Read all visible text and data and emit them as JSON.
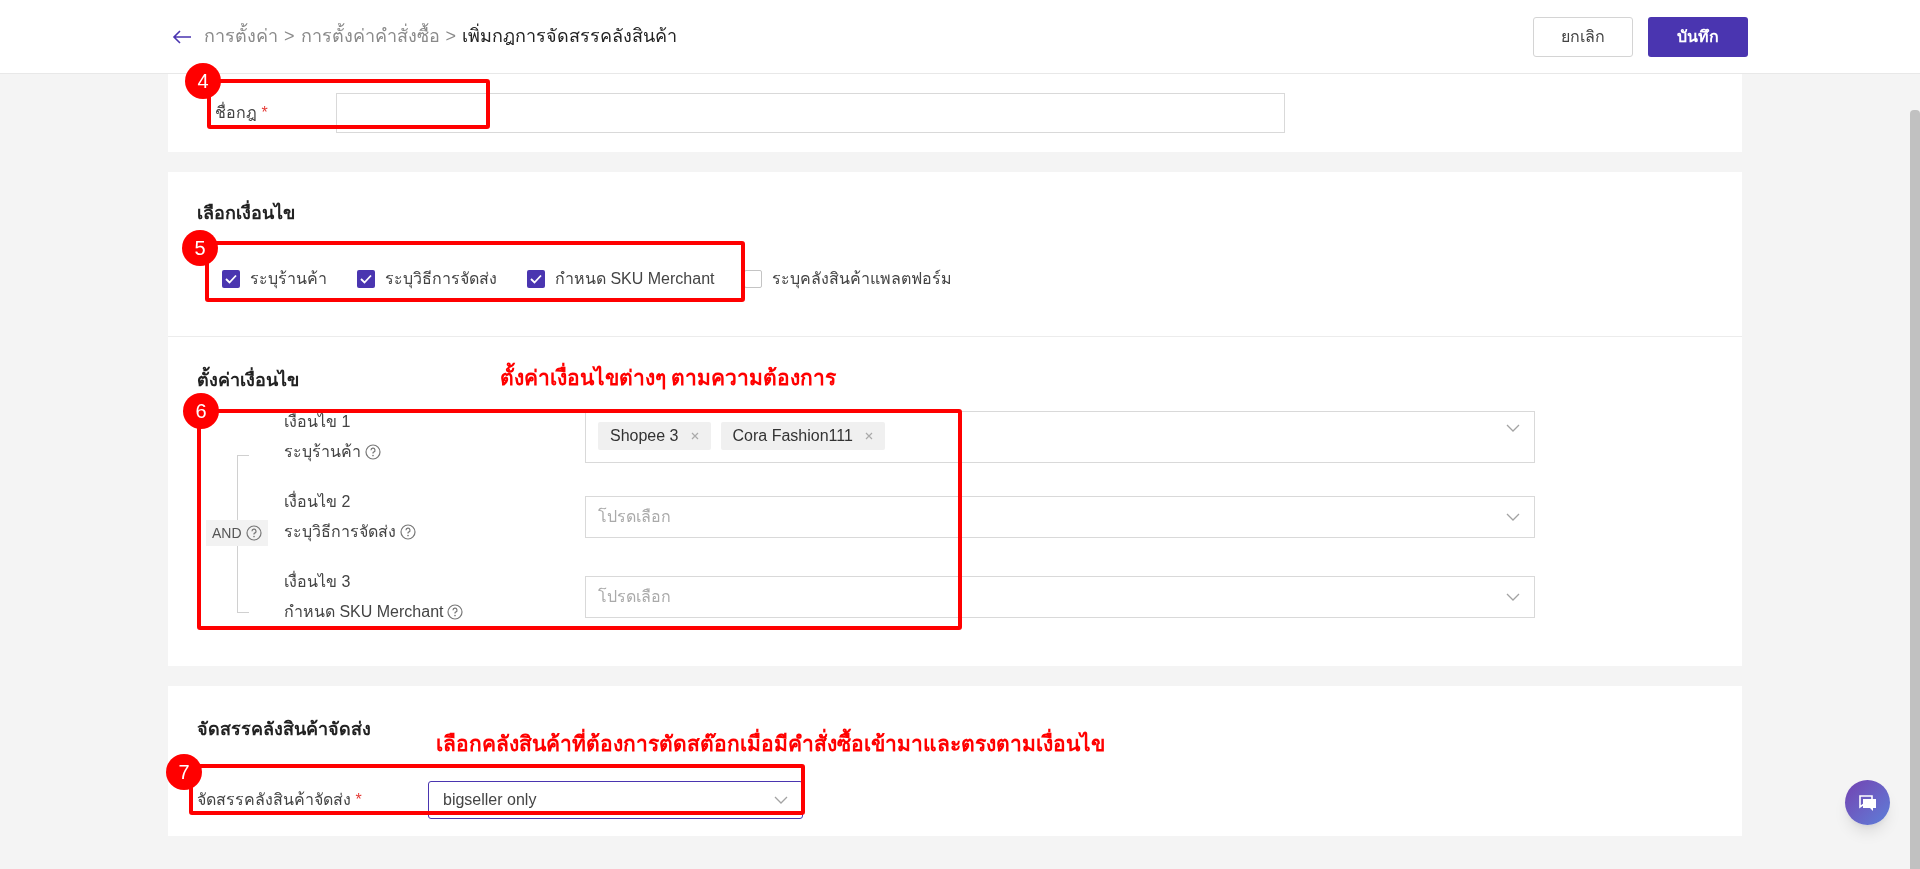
{
  "header": {
    "breadcrumb": [
      {
        "label": "การตั้งค่า",
        "current": false
      },
      {
        "label": "การตั้งค่าคำสั่งซื้อ",
        "current": false
      },
      {
        "label": "เพิ่มกฎการจัดสรรคลังสินค้า",
        "current": true
      }
    ],
    "separator": ">",
    "buttons": [
      {
        "label": "ยกเลิก",
        "kind": "secondary"
      },
      {
        "label": "บันทึก",
        "kind": "primary"
      }
    ]
  },
  "rule_name": {
    "label": "ชื่อกฎ",
    "required_mark": "*"
  },
  "condition_select": {
    "title": "เลือกเงื่อนไข",
    "options": [
      {
        "label": "ระบุร้านค้า",
        "checked": true
      },
      {
        "label": "ระบุวิธีการจัดส่ง",
        "checked": true
      },
      {
        "label": "กำหนด SKU Merchant",
        "checked": true
      },
      {
        "label": "ระบุคลังสินค้าแพลตฟอร์ม",
        "checked": false
      }
    ]
  },
  "condition_settings": {
    "title": "ตั้งค่าเงื่อนไข",
    "operator": "AND",
    "conditions": [
      {
        "number": "เงื่อนไข 1",
        "label": "ระบุร้านค้า",
        "tags": [
          {
            "label": "Shopee 3"
          },
          {
            "label": "Cora Fashion111"
          }
        ]
      },
      {
        "number": "เงื่อนไข 2",
        "label": "ระบุวิธีการจัดส่ง",
        "placeholder": "โปรดเลือก"
      },
      {
        "number": "เงื่อนไข 3",
        "label": "กำหนด SKU Merchant",
        "placeholder": "โปรดเลือก"
      }
    ]
  },
  "allocation": {
    "title": "จัดสรรคลังสินค้าจัดส่ง",
    "label": "จัดสรรคลังสินค้าจัดส่ง",
    "required_mark": "*",
    "value": "bigseller only"
  },
  "annotations": [
    {
      "number": "4"
    },
    {
      "number": "5"
    },
    {
      "number": "6",
      "note": "ตั้งค่าเงื่อนไขต่างๆ ตามความต้องการ"
    },
    {
      "number": "7",
      "note": "เลือกคลังสินค้าที่ต้องการตัดสต๊อกเมื่อมีคำสั่งซื้อเข้ามาและตรงตามเงื่อนไข"
    }
  ]
}
